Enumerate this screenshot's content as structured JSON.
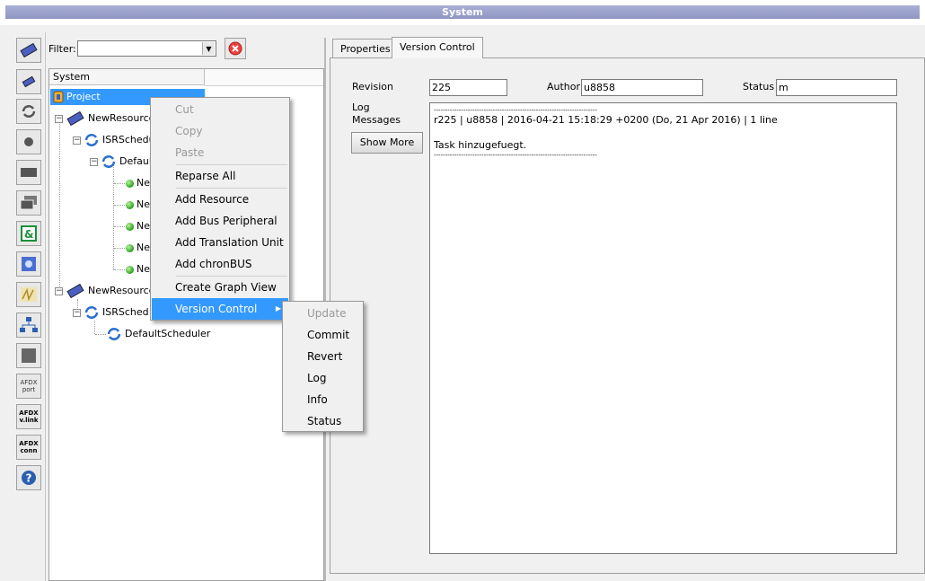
{
  "window": {
    "title": "System"
  },
  "toolbar": {
    "items": [
      {
        "name": "resource-icon"
      },
      {
        "name": "bus-icon"
      },
      {
        "name": "scheduler-icon"
      },
      {
        "name": "circle-icon"
      },
      {
        "name": "rectangle-icon"
      },
      {
        "name": "stack-icon"
      },
      {
        "name": "translation-unit-icon"
      },
      {
        "name": "timer-icon"
      },
      {
        "name": "signal-icon"
      },
      {
        "name": "network-icon"
      },
      {
        "name": "square-icon"
      },
      {
        "name": "afdx-port-icon",
        "label": "AFDX port"
      },
      {
        "name": "afdx-vlink-icon",
        "label": "AFDX v.link"
      },
      {
        "name": "afdx-conn-icon",
        "label": "AFDX conn"
      },
      {
        "name": "help-icon"
      }
    ]
  },
  "filter": {
    "label": "Filter:",
    "value": ""
  },
  "tree": {
    "header": "System",
    "nodes": {
      "project": "Project",
      "res1": "NewResource",
      "sched1": "ISRSchedu",
      "defsched1": "Defaul",
      "n1": "Ne",
      "n2": "Ne",
      "n3": "Ne",
      "n4": "Ne",
      "n5": "Ne",
      "res2": "NewResource_",
      "sched2": "ISRSched",
      "defsched2": "DefaultScheduler"
    }
  },
  "context_menu": {
    "cut": "Cut",
    "copy": "Copy",
    "paste": "Paste",
    "reparse": "Reparse All",
    "add_resource": "Add Resource",
    "add_bus": "Add Bus Peripheral",
    "add_tu": "Add Translation Unit",
    "add_chronbus": "Add chronBUS",
    "create_graph": "Create Graph View",
    "version_control": "Version Control"
  },
  "submenu": {
    "update": "Update",
    "commit": "Commit",
    "revert": "Revert",
    "log": "Log",
    "info": "Info",
    "status": "Status"
  },
  "tabs": {
    "properties": "Properties",
    "version_control": "Version Control"
  },
  "vc": {
    "revision_label": "Revision",
    "revision_value": "225",
    "author_label": "Author",
    "author_value": "u8858",
    "status_label": "Status",
    "status_value": "m",
    "log_label_1": "Log",
    "log_label_2": "Messages",
    "show_more": "Show More",
    "log_lines": [
      "------------------------------------------------------------------------",
      "r225 | u8858 | 2016-04-21 15:18:29 +0200 (Do, 21 Apr 2016) | 1 line",
      "",
      "Task hinzugefuegt.",
      "------------------------------------------------------------------------"
    ]
  }
}
